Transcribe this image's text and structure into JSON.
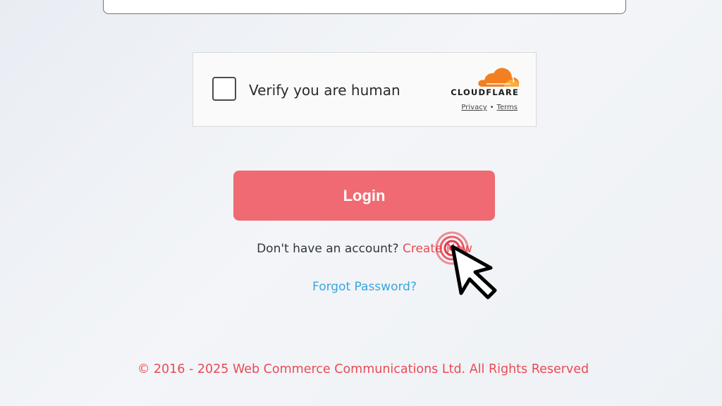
{
  "captcha": {
    "label": "Verify you are human",
    "provider": "CLOUDFLARE",
    "privacy_link": "Privacy",
    "separator": "•",
    "terms_link": "Terms",
    "brand_color": "#f38020"
  },
  "login": {
    "button_label": "Login",
    "button_color": "#ef6a73"
  },
  "signup": {
    "prompt": "Don't have an account?",
    "link": "Create Now"
  },
  "forgot_password": "Forgot Password?",
  "footer": {
    "copyright": "© 2016 - 2025 Web Commerce Communications Ltd. All Rights Reserved"
  },
  "colors": {
    "accent_red": "#e94b55",
    "link_blue": "#3aa6dd"
  },
  "cursor": {
    "icon": "pointer-arrow-icon",
    "click_indicator": "click-ripple-icon"
  }
}
